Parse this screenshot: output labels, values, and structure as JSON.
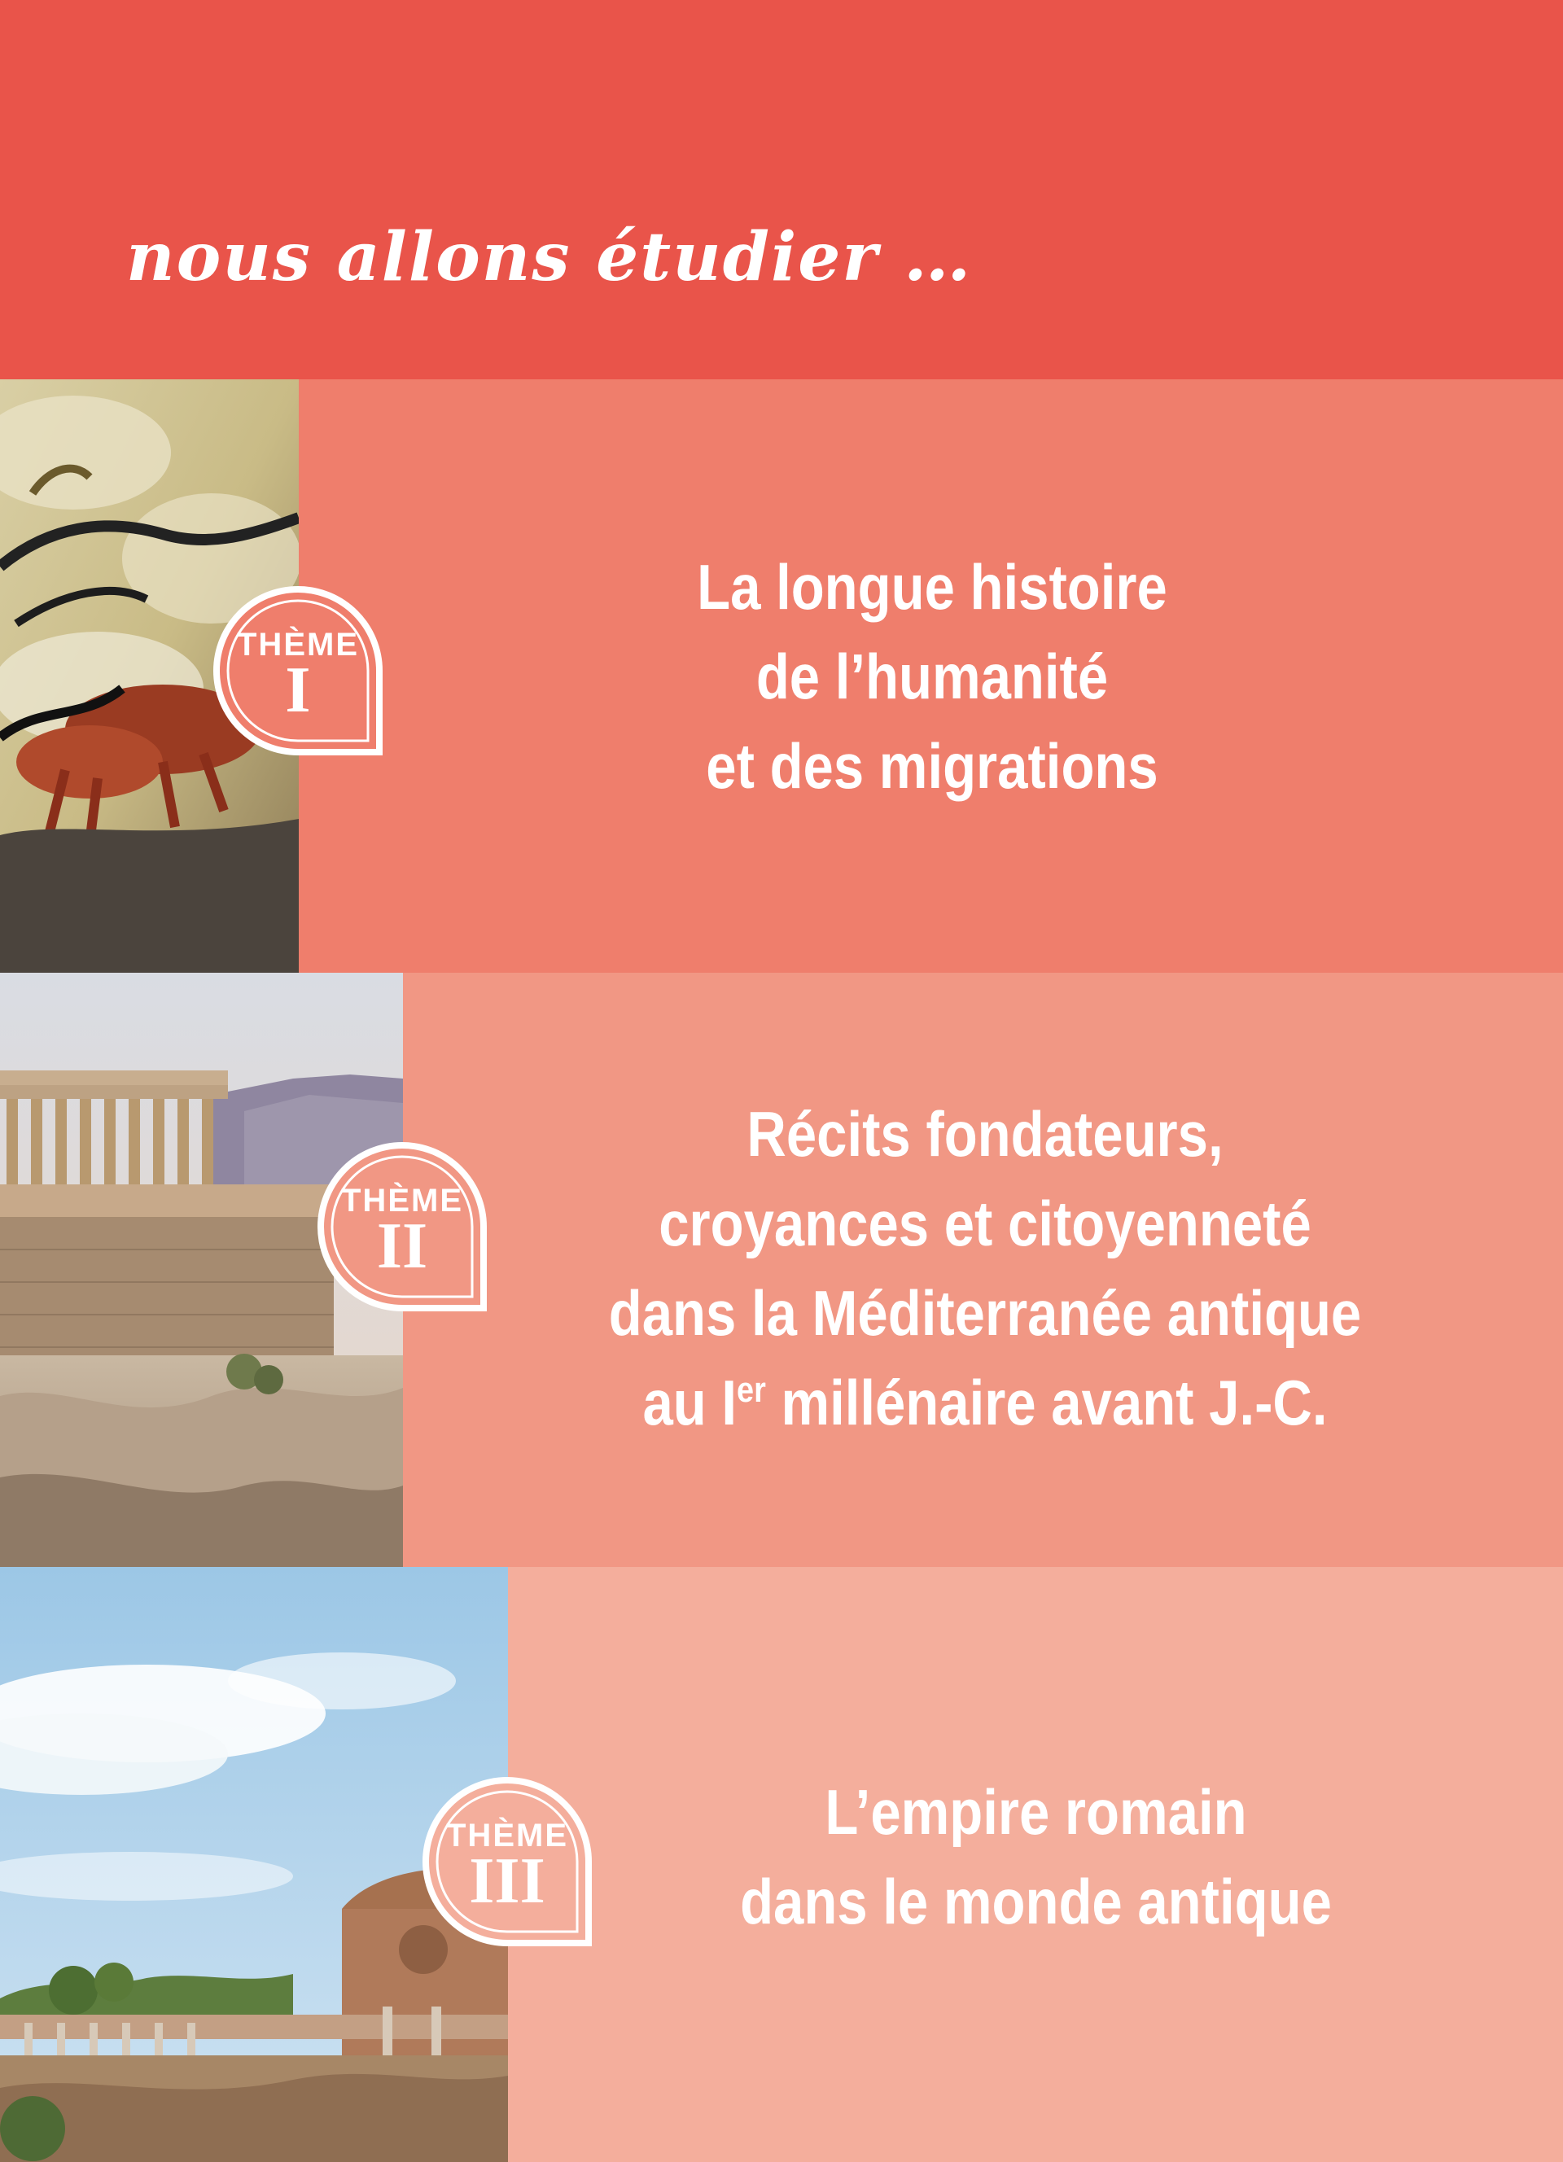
{
  "header": {
    "title": "nous allons étudier …"
  },
  "themes": [
    {
      "label": "THÈME",
      "numeral": "I",
      "title_lines": [
        "La longue histoire",
        "de l’humanité",
        "et des migrations"
      ],
      "image": "lascaux-cave-painting"
    },
    {
      "label": "THÈME",
      "numeral": "II",
      "title_lines": [
        "Récits fondateurs,",
        "croyances et citoyenneté",
        "dans la Méditerranée antique"
      ],
      "title_last_line": {
        "prefix": "au I",
        "superscript": "er",
        "suffix": " millénaire avant J.-C."
      },
      "image": "acropolis-athens"
    },
    {
      "label": "THÈME",
      "numeral": "III",
      "title_lines": [
        "L’empire romain",
        "dans le monde antique"
      ],
      "image": "roman-forum-ruins"
    }
  ],
  "colors": {
    "header": "#e9544a",
    "band_1": "#ef7e6c",
    "band_2": "#f19784",
    "band_3": "#f4ae9c"
  }
}
